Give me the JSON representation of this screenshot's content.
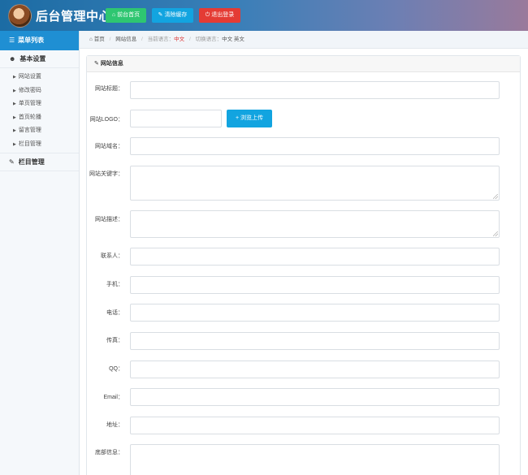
{
  "header": {
    "title": "后台管理中心",
    "buttons": {
      "home": "前台首页",
      "clear_cache": "清除缓存",
      "logout": "退出登录"
    }
  },
  "sidebar": {
    "heading": "菜单列表",
    "group1": "基本设置",
    "items": [
      "网站设置",
      "修改密码",
      "单页管理",
      "首页轮播",
      "留言管理",
      "栏目管理"
    ],
    "group2": "栏目管理"
  },
  "breadcrumb": {
    "home": "首页",
    "current": "网站信息",
    "lang_label": "当前语言：",
    "lang_value": "中文",
    "switch_label": "切换语言：",
    "switch_cn": "中文",
    "switch_en": "英文"
  },
  "panel": {
    "title": "网站信息"
  },
  "form": {
    "site_title_label": "网站标题：",
    "logo_label": "网站LOGO：",
    "upload_label": "+ 浏览上传",
    "domain_label": "网站域名：",
    "keywords_label": "网站关键字：",
    "description_label": "网站描述：",
    "contact_label": "联系人：",
    "mobile_label": "手机：",
    "phone_label": "电话：",
    "fax_label": "传真：",
    "qq_label": "QQ：",
    "email_label": "Email：",
    "address_label": "地址：",
    "footer_label": "底部信息："
  },
  "colors": {
    "home_button": "#2ec671",
    "clear_button": "#12a4e0",
    "logout_button": "#e43b34",
    "sidebar_heading": "#1f8fd3"
  }
}
